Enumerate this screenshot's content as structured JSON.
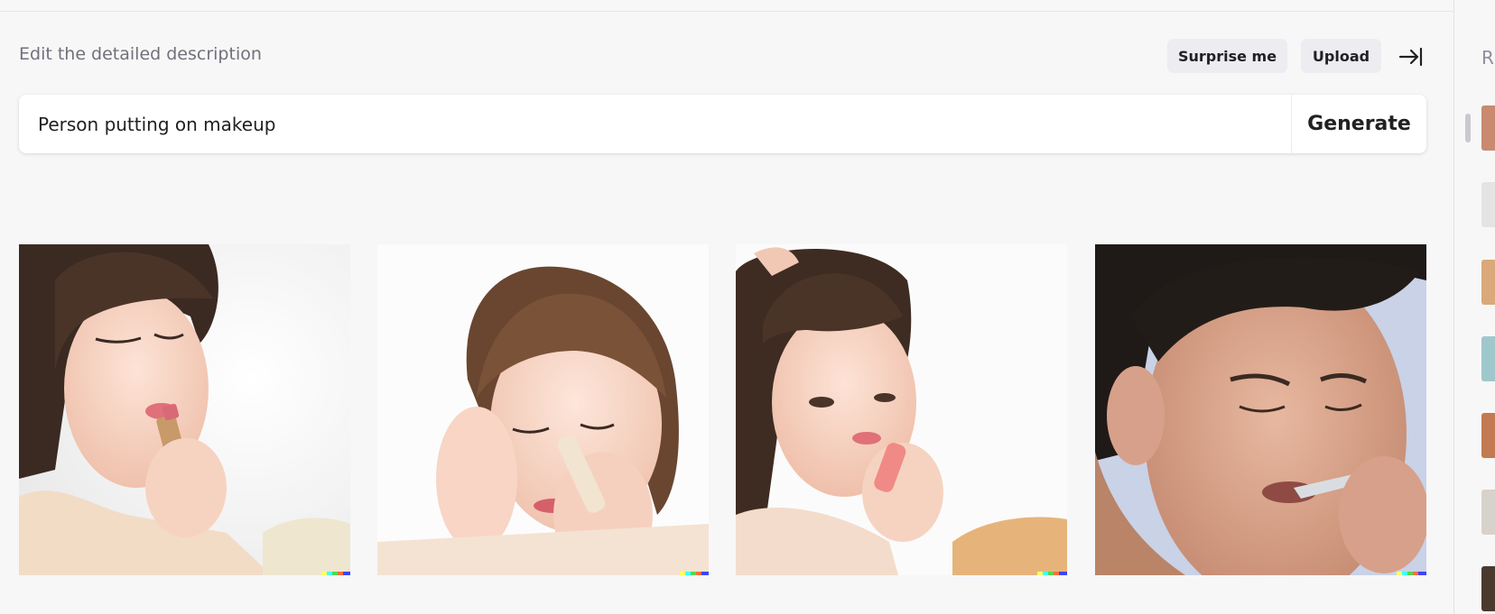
{
  "prompt_panel": {
    "heading": "Edit the detailed description",
    "surprise_label": "Surprise me",
    "upload_label": "Upload",
    "collapse_icon": "arrow-right-to-bar-icon",
    "prompt_value": "Person putting on makeup",
    "generate_label": "Generate"
  },
  "results": {
    "images": [
      {
        "subject": "woman applying lipstick",
        "icon": "generated-image"
      },
      {
        "subject": "woman applying eye makeup",
        "icon": "generated-image"
      },
      {
        "subject": "woman holding lip gloss",
        "icon": "generated-image"
      },
      {
        "subject": "man biting a fork",
        "icon": "generated-image"
      }
    ],
    "signature_colors": [
      "#ffff66",
      "#42ffff",
      "#51da4c",
      "#ff6e3c",
      "#3c46ff"
    ]
  },
  "history_sidebar": {
    "header_fragment": "R",
    "thumbnail_count": 7
  },
  "colors": {
    "background": "#f7f7f8",
    "button_bg": "#ececf1",
    "text": "#202123",
    "muted": "#70717a"
  }
}
